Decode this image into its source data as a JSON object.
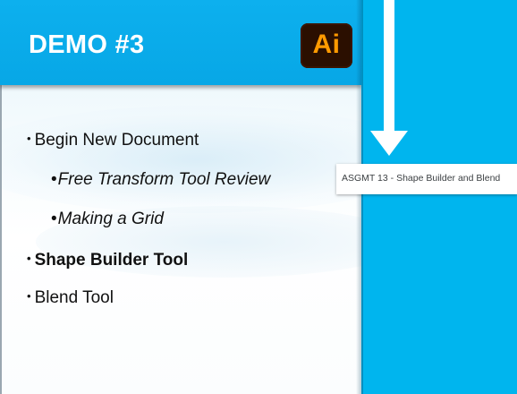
{
  "header": {
    "title": "DEMO #3",
    "logo_text": "Ai",
    "bar_color": "#07a7e6"
  },
  "logo": {
    "icon": "adobe-illustrator-icon",
    "background_color": "#2b0f00",
    "text_color": "#ff9a00"
  },
  "bullets": [
    {
      "marker": "•",
      "text": "Begin New Document",
      "style": "normal"
    },
    {
      "marker": "•",
      "text": "Free Transform Tool Review",
      "style": "italic"
    },
    {
      "marker": "•",
      "text": "Making a Grid",
      "style": "italic"
    },
    {
      "marker": "•",
      "text": "Shape Builder Tool",
      "style": "bold"
    },
    {
      "marker": "•",
      "text": "Blend Tool",
      "style": "normal"
    }
  ],
  "right_panel": {
    "background_color": "#00b5ee",
    "arrow_icon": "down-arrow-icon",
    "assignment_label": "ASGMT 13 - Shape Builder and Blend"
  }
}
